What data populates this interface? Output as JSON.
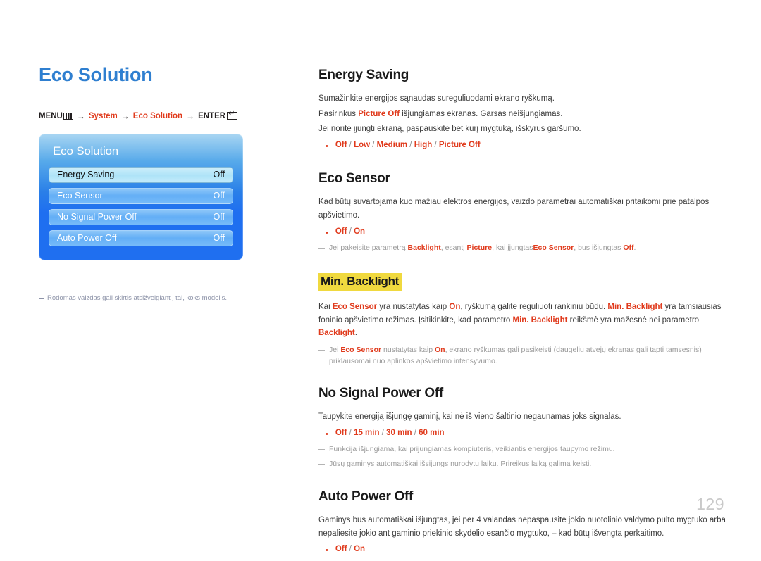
{
  "page": {
    "title": "Eco Solution",
    "number": "129"
  },
  "menu_path": {
    "menu_label": "MENU",
    "menu_icon": "menu-grid-icon",
    "arrow": "→",
    "step1": "System",
    "step2": "Eco Solution",
    "enter_label": "ENTER",
    "enter_icon": "enter-return-icon"
  },
  "osd": {
    "title": "Eco Solution",
    "rows": [
      {
        "label": "Energy Saving",
        "value": "Off",
        "selected": true
      },
      {
        "label": "Eco Sensor",
        "value": "Off",
        "selected": false
      },
      {
        "label": "No Signal Power Off",
        "value": "Off",
        "selected": false
      },
      {
        "label": "Auto Power Off",
        "value": "Off",
        "selected": false
      }
    ]
  },
  "left_note": "Rodomas vaizdas gali skirtis atsižvelgiant į tai, koks modelis.",
  "sections": {
    "energy_saving": {
      "title": "Energy Saving",
      "line1": "Sumažinkite energijos sąnaudas sureguliuodami ekrano ryškumą.",
      "line2_a": "Pasirinkus ",
      "line2_red": "Picture Off",
      "line2_b": " išjungiamas ekranas. Garsas neišjungiamas.",
      "line3": "Jei norite įjungti ekraną, paspauskite bet kurį mygtuką, išskyrus garšumo.",
      "options": [
        "Off",
        "Low",
        "Medium",
        "High",
        "Picture Off"
      ]
    },
    "eco_sensor": {
      "title": "Eco Sensor",
      "line1": "Kad būtų suvartojama kuo mažiau elektros energijos, vaizdo parametrai automatiškai pritaikomi prie patalpos apšvietimo.",
      "options": [
        "Off",
        "On"
      ],
      "note_a": "Jei pakeisite parametrą ",
      "note_b1": "Backlight",
      "note_c": ", esantį ",
      "note_b2": "Picture",
      "note_d": ", kai įjungtas",
      "note_b3": "Eco Sensor",
      "note_e": ", bus išjungtas ",
      "note_b4": "Off",
      "note_f": "."
    },
    "min_backlight": {
      "title": "Min. Backlight",
      "p_a": "Kai ",
      "p_b1": "Eco Sensor",
      "p_c": " yra nustatytas kaip ",
      "p_b2": "On",
      "p_d": ", ryškumą galite reguliuoti rankiniu būdu. ",
      "p_b3": "Min. Backlight",
      "p_e": " yra tamsiausias foninio apšvietimo režimas. Įsitikinkite, kad parametro ",
      "p_b4": "Min. Backlight",
      "p_f": " reikšmė yra mažesnė nei parametro ",
      "p_b5": "Backlight",
      "p_g": ".",
      "note_a": "Jei ",
      "note_b1": "Eco Sensor",
      "note_c": " nustatytas kaip ",
      "note_b2": "On",
      "note_d": ", ekrano ryškumas gali pasikeisti (daugeliu atvejų ekranas gali tapti tamsesnis) priklausomai nuo aplinkos apšvietimo intensyvumo."
    },
    "no_signal_power_off": {
      "title": "No Signal Power Off",
      "line1": "Taupykite energiją išjungę gaminį, kai nė iš vieno šaltinio negaunamas joks signalas.",
      "options": [
        "Off",
        "15 min",
        "30 min",
        "60 min"
      ],
      "note1": "Funkcija išjungiama, kai prijungiamas kompiuteris, veikiantis energijos taupymo režimu.",
      "note2": "Jūsų gaminys automatiškai išsijungs nurodytu laiku. Prireikus laiką galima keisti."
    },
    "auto_power_off": {
      "title": "Auto Power Off",
      "line1": "Gaminys bus automatiškai išjungtas, jei per 4 valandas nepaspausite jokio nuotolinio valdymo pulto mygtuko arba nepaliesite jokio ant gaminio priekinio skydelio esančio mygtuko, – kad būtų išvengta perkaitimo.",
      "options": [
        "Off",
        "On"
      ]
    }
  },
  "colors": {
    "title_blue": "#2f7fd0",
    "accent_red": "#e03a1c",
    "highlight_yellow": "#f0d93f",
    "osd_blue": "#1f6ff0"
  }
}
